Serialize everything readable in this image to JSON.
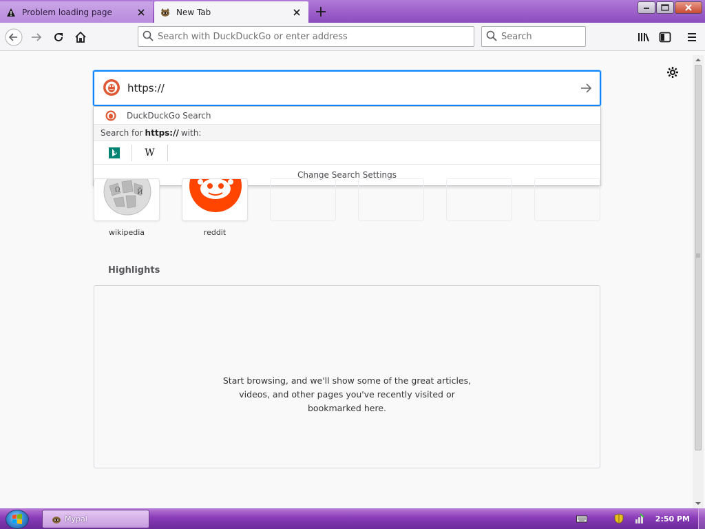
{
  "tabs": [
    {
      "title": "Problem loading page",
      "icon": "warning-icon",
      "active": false
    },
    {
      "title": "New Tab",
      "icon": "mypal-icon",
      "active": true
    }
  ],
  "toolbar": {
    "url_placeholder": "Search with DuckDuckGo or enter address",
    "search_placeholder": "Search"
  },
  "home_search": {
    "value": "https://",
    "engine_icon": "duckduckgo-icon"
  },
  "suggestions": {
    "engine_label": "DuckDuckGo Search",
    "search_for_prefix": "Search for",
    "search_for_query": "https://",
    "search_for_suffix": "with:",
    "engines": [
      "bing-icon",
      "wikipedia-icon"
    ],
    "wiki_glyph": "W",
    "settings_label": "Change Search Settings"
  },
  "top_sites": [
    {
      "label": "wikipedia"
    },
    {
      "label": "reddit"
    },
    {
      "label": ""
    },
    {
      "label": ""
    },
    {
      "label": ""
    },
    {
      "label": ""
    }
  ],
  "highlights": {
    "title": "Highlights",
    "message_line1": "Start browsing, and we'll show some of the great articles,",
    "message_line2": "videos, and other pages you've recently visited or",
    "message_line3": "bookmarked here."
  },
  "taskbar": {
    "app_label": "Mypal",
    "clock": "2:50 PM"
  },
  "colors": {
    "accent": "#0a84ff",
    "reddit": "#ff4500",
    "duckduckgo": "#de5833",
    "bing": "#008373"
  }
}
